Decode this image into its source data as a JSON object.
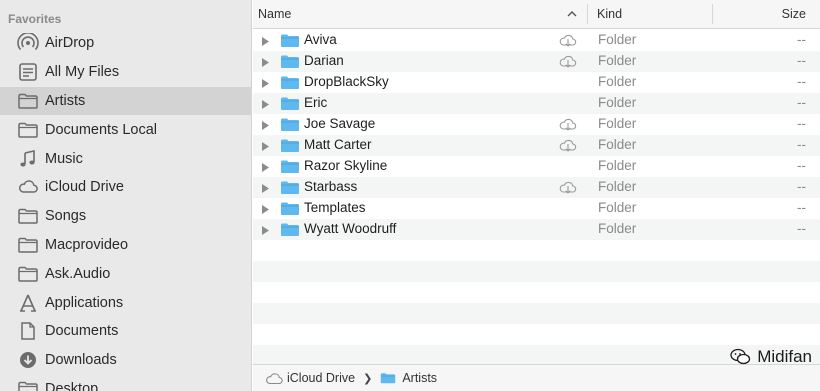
{
  "sidebar": {
    "heading": "Favorites",
    "items": [
      {
        "label": "AirDrop",
        "icon": "airdrop-icon"
      },
      {
        "label": "All My Files",
        "icon": "all-files-icon"
      },
      {
        "label": "Artists",
        "icon": "folder-icon"
      },
      {
        "label": "Documents Local",
        "icon": "folder-icon"
      },
      {
        "label": "Music",
        "icon": "music-icon"
      },
      {
        "label": "iCloud Drive",
        "icon": "cloud-icon"
      },
      {
        "label": "Songs",
        "icon": "folder-icon"
      },
      {
        "label": "Macprovideo",
        "icon": "folder-icon"
      },
      {
        "label": "Ask.Audio",
        "icon": "folder-icon"
      },
      {
        "label": "Applications",
        "icon": "applications-icon"
      },
      {
        "label": "Documents",
        "icon": "documents-icon"
      },
      {
        "label": "Downloads",
        "icon": "downloads-icon"
      },
      {
        "label": "Desktop",
        "icon": "folder-icon"
      }
    ],
    "selected": "Artists"
  },
  "columns": {
    "name": "Name",
    "kind": "Kind",
    "size": "Size"
  },
  "files": [
    {
      "name": "Aviva",
      "kind": "Folder",
      "size": "--",
      "cloud": true
    },
    {
      "name": "Darian",
      "kind": "Folder",
      "size": "--",
      "cloud": true
    },
    {
      "name": "DropBlackSky",
      "kind": "Folder",
      "size": "--",
      "cloud": false
    },
    {
      "name": "Eric",
      "kind": "Folder",
      "size": "--",
      "cloud": false
    },
    {
      "name": "Joe Savage",
      "kind": "Folder",
      "size": "--",
      "cloud": true
    },
    {
      "name": "Matt Carter",
      "kind": "Folder",
      "size": "--",
      "cloud": true
    },
    {
      "name": "Razor Skyline",
      "kind": "Folder",
      "size": "--",
      "cloud": false
    },
    {
      "name": "Starbass",
      "kind": "Folder",
      "size": "--",
      "cloud": true
    },
    {
      "name": "Templates",
      "kind": "Folder",
      "size": "--",
      "cloud": false
    },
    {
      "name": "Wyatt Woodruff",
      "kind": "Folder",
      "size": "--",
      "cloud": false
    }
  ],
  "pathbar": {
    "root": "iCloud Drive",
    "current": "Artists"
  },
  "watermark": {
    "text": "Midifan"
  },
  "colors": {
    "folder": "#5fb8ee",
    "selection": "#d3d3d3",
    "sidebar_bg": "#e9e9e9"
  }
}
